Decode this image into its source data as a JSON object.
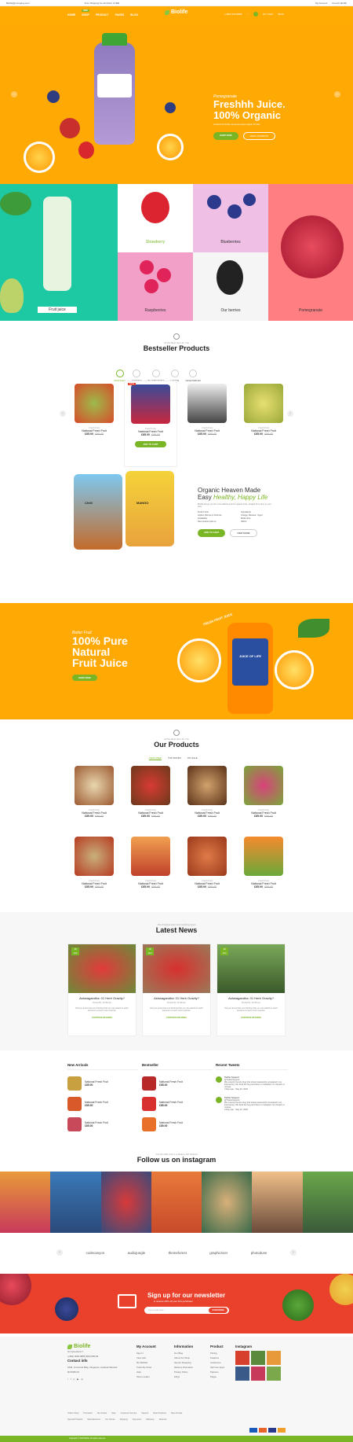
{
  "topbar": {
    "email": "Biolife@company.com",
    "shipping": "Free Shipping for all Order of $99",
    "account": "My Account",
    "lang": "French (EUR)"
  },
  "header": {
    "nav": [
      "HOME",
      "SHOP",
      "PRODUCT",
      "PAGES",
      "BLOG"
    ],
    "badge": "NEW",
    "logo": "Biolife",
    "phone": "(+800) 666-8888",
    "cart_label": "MY CART",
    "cart_total": "$0.00"
  },
  "hero": {
    "pre": "Pomegranate",
    "title_line1": "Freshhh Juice.",
    "title_line2": "100% Organic",
    "desc": "A blend of freshly squeezed green apple & fruits",
    "btn_shop": "SHOP NOW",
    "btn_view": "VIEW LOOKBOOK"
  },
  "categories": {
    "fruit_juice": "Fruit juice",
    "strawberry": "Strawberry",
    "blueberries": "Blueberries",
    "raspberries": "Raspberries",
    "our_berries": "Our berries",
    "pomegranate": "Pomegranate"
  },
  "bestseller": {
    "small": "All the Best Item for You",
    "title": "Bestseller Products",
    "tabs": [
      "ORANGES",
      "GRAPES",
      "BLUEBERRIES",
      "LEMON",
      "VEGETABLES"
    ],
    "products": [
      {
        "cat": "Fresh Fruit",
        "name": "National Fresh Fruit",
        "price": "£85.00",
        "old": "£95.00"
      },
      {
        "cat": "Fresh Fruit",
        "name": "National Fresh Fruit",
        "price": "£85.00",
        "old": "£95.00"
      },
      {
        "cat": "Fresh Fruit",
        "name": "National Fresh Fruit",
        "price": "£85.00",
        "old": "£95.00"
      },
      {
        "cat": "Fresh Fruit",
        "name": "National Fresh Fruit",
        "price": "£85.00",
        "old": "£95.00"
      }
    ],
    "add_to_cart": "ADD TO CART",
    "sale_badge": "SALE"
  },
  "featured": {
    "pack1": "Chilli",
    "pack2": "MANGO",
    "title1": "Organic Heaven Made",
    "title2_plain": "Easy",
    "title2_italic": "Healthy, Happy Life",
    "desc": "Biolife brings you the most delicious fresh organic fruits, straight from farm to your door.",
    "specs": [
      [
        "Fresh Fruits",
        "Ingredients"
      ],
      [
        "Apples, Berries & Cherries",
        "Orange, Banana, Yogurt"
      ],
      [
        "Availability",
        "Bottle Size"
      ],
      [
        "New product pick up",
        "350ml"
      ]
    ],
    "btn_add": "ADD TO CART",
    "btn_view": "VIEW MORE"
  },
  "juice_banner": {
    "small": "Better Fruit",
    "line1": "100% Pure",
    "line2": "Natural",
    "line3": "Fruit Juice",
    "btn": "SHOP NOW",
    "badge": "JUICE OF LIFE",
    "curve": "FRESH FRUIT JUICE"
  },
  "our_products": {
    "small": "All the Best Item for You",
    "title": "Our Products",
    "tabs": [
      "FEATURED",
      "TOP RATED",
      "ON SALE"
    ],
    "products": [
      {
        "cat": "Fresh Fruit",
        "name": "National Fresh Fruit",
        "price": "£85.00",
        "old": "£95.00"
      },
      {
        "cat": "Fresh Fruit",
        "name": "National Fresh Fruit",
        "price": "£85.00",
        "old": "£95.00"
      },
      {
        "cat": "Fresh Fruit",
        "name": "National Fresh Fruit",
        "price": "£85.00",
        "old": "£95.00"
      },
      {
        "cat": "Fresh Fruit",
        "name": "National Fresh Fruit",
        "price": "£85.00",
        "old": "£95.00"
      },
      {
        "cat": "Fresh Fruit",
        "name": "National Fresh Fruit",
        "price": "£85.00",
        "old": "£95.00"
      },
      {
        "cat": "Fresh Fruit",
        "name": "National Fresh Fruit",
        "price": "£85.00",
        "old": "£95.00"
      },
      {
        "cat": "Fresh Fruit",
        "name": "National Fresh Fruit",
        "price": "£85.00",
        "old": "£95.00"
      },
      {
        "cat": "Fresh Fruit",
        "name": "National Fresh Fruit",
        "price": "£85.00",
        "old": "£95.00"
      }
    ]
  },
  "news": {
    "small": "The freshest and most exciting news",
    "title": "Latest News",
    "items": [
      {
        "day": "19",
        "month": "Jan",
        "title": "Ashwagandha: 01 Herb Gravity?",
        "by": "Posted By: Mr.Brown",
        "excerpt": "Did you know that one thinking that you can attach to each resource to learn more anytime.",
        "more": "CONTINUE READING"
      },
      {
        "day": "19",
        "month": "Jan",
        "title": "Ashwagandha: 01 Herb Gravity?",
        "by": "Posted By: Mr.Brown",
        "excerpt": "Did you know that one thinking that you can attach to each resource to learn more anytime.",
        "more": "CONTINUE READING"
      },
      {
        "day": "19",
        "month": "Jan",
        "title": "Ashwagandha: 01 Herb Gravity?",
        "by": "Posted By: Mr.Brown",
        "excerpt": "Did you know that one thinking that you can attach to each resource to learn more anytime.",
        "more": "CONTINUE READING"
      }
    ]
  },
  "lists": {
    "new_arrivals": "New Arrivals",
    "bestseller": "Bestseller",
    "recent_tweets": "Recent Tweets",
    "item_name": "National Fresh Fruit",
    "item_price": "£85.00",
    "tweets": [
      {
        "name": "Twitter Support",
        "handle": "@TwitterSupport",
        "text": "We recently found a bug that stored passwords unmasked in an internal log. We fixed the bug and have no indication of a breach or misuse.",
        "date": "3 Day Ago · May 20, 2020"
      },
      {
        "name": "Twitter Support",
        "handle": "@TwitterSupport",
        "text": "We recently found a bug that stored passwords unmasked in an internal log. We fixed the bug and have no indication of a breach or misuse.",
        "date": "3 Day Ago · May 20, 2020"
      }
    ]
  },
  "instagram": {
    "small": "Our Eco-Bio-Life is a Nature Ath Natural",
    "title": "Follow us on instagram"
  },
  "brands": [
    "codecanyon",
    "audiojungle",
    "themeforest",
    "graphicriver",
    "photodune"
  ],
  "newsletter": {
    "title": "Sign up for our newsletter",
    "sub": "& receive 20% off your first purchase!",
    "placeholder": "Your email here...",
    "btn": "SUBSCRIBE"
  },
  "footer": {
    "logo": "Biolife",
    "questions": "Got Questions ?",
    "phone": "(+800) 6666-8888 (800) 895-99",
    "contact_h": "Contact info",
    "address": "1003, 1st Grand Bldg, Singapore, Guidesk Marwad 6DT6R8 US",
    "account_h": "My Account",
    "account": [
      "Sign In",
      "View Cart",
      "My Wishlist",
      "Track My Order",
      "Help",
      "Store Locator"
    ],
    "info_h": "Information",
    "info": [
      "Our Blog",
      "About Our Shop",
      "Secure Shopping",
      "Delivery Infomation",
      "Privacy Policy",
      "FAQs"
    ],
    "product_h": "Product",
    "product": [
      "Pricing",
      "Features",
      "Customers",
      "Sell Your Apps",
      "Partners",
      "Pages"
    ],
    "insta_h": "Instagram",
    "links": [
      "Online Shop",
      "Promotion",
      "My Orders",
      "Help",
      "Customer Service",
      "Support",
      "Most Populars",
      "New Arrivals",
      "Special Products",
      "Manufacturers",
      "Our Stores",
      "Shipping",
      "Payments",
      "Warranty",
      "Refunds"
    ],
    "copyright": "Copyright © 2020 Biolife. All rights reserved"
  },
  "colors": {
    "orange": "#ffa904",
    "green": "#7ab526",
    "red": "#e9412b"
  }
}
